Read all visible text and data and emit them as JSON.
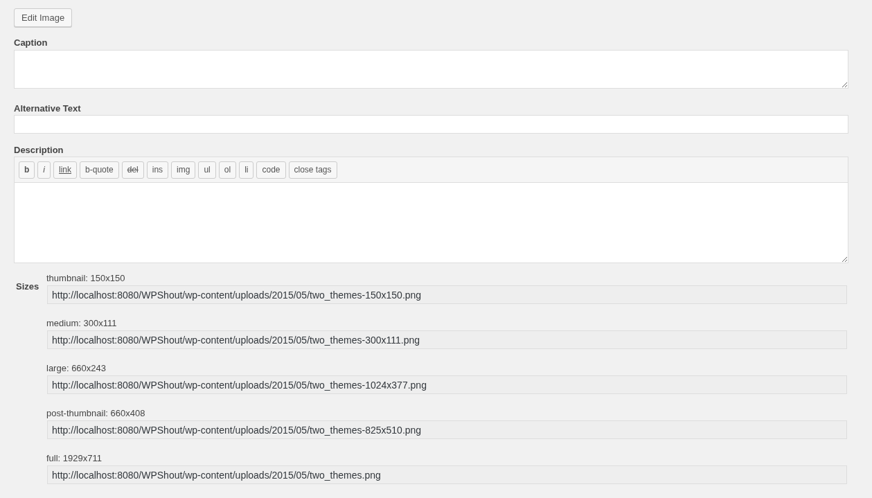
{
  "edit_button": "Edit Image",
  "caption": {
    "label": "Caption"
  },
  "alt_text": {
    "label": "Alternative Text"
  },
  "description": {
    "label": "Description",
    "toolbar": [
      {
        "label": "b",
        "kind": "bold"
      },
      {
        "label": "i",
        "kind": "italic"
      },
      {
        "label": "link",
        "kind": "underline"
      },
      {
        "label": "b-quote",
        "kind": "plain"
      },
      {
        "label": "del",
        "kind": "strike"
      },
      {
        "label": "ins",
        "kind": "plain"
      },
      {
        "label": "img",
        "kind": "plain"
      },
      {
        "label": "ul",
        "kind": "plain"
      },
      {
        "label": "ol",
        "kind": "plain"
      },
      {
        "label": "li",
        "kind": "plain"
      },
      {
        "label": "code",
        "kind": "plain"
      },
      {
        "label": "close tags",
        "kind": "plain"
      }
    ]
  },
  "sizes": {
    "label": "Sizes",
    "items": [
      {
        "label": "thumbnail: 150x150",
        "value": "http://localhost:8080/WPShout/wp-content/uploads/2015/05/two_themes-150x150.png"
      },
      {
        "label": "medium: 300x111",
        "value": "http://localhost:8080/WPShout/wp-content/uploads/2015/05/two_themes-300x111.png"
      },
      {
        "label": "large: 660x243",
        "value": "http://localhost:8080/WPShout/wp-content/uploads/2015/05/two_themes-1024x377.png"
      },
      {
        "label": "post-thumbnail: 660x408",
        "value": "http://localhost:8080/WPShout/wp-content/uploads/2015/05/two_themes-825x510.png"
      },
      {
        "label": "full: 1929x711",
        "value": "http://localhost:8080/WPShout/wp-content/uploads/2015/05/two_themes.png"
      }
    ]
  }
}
